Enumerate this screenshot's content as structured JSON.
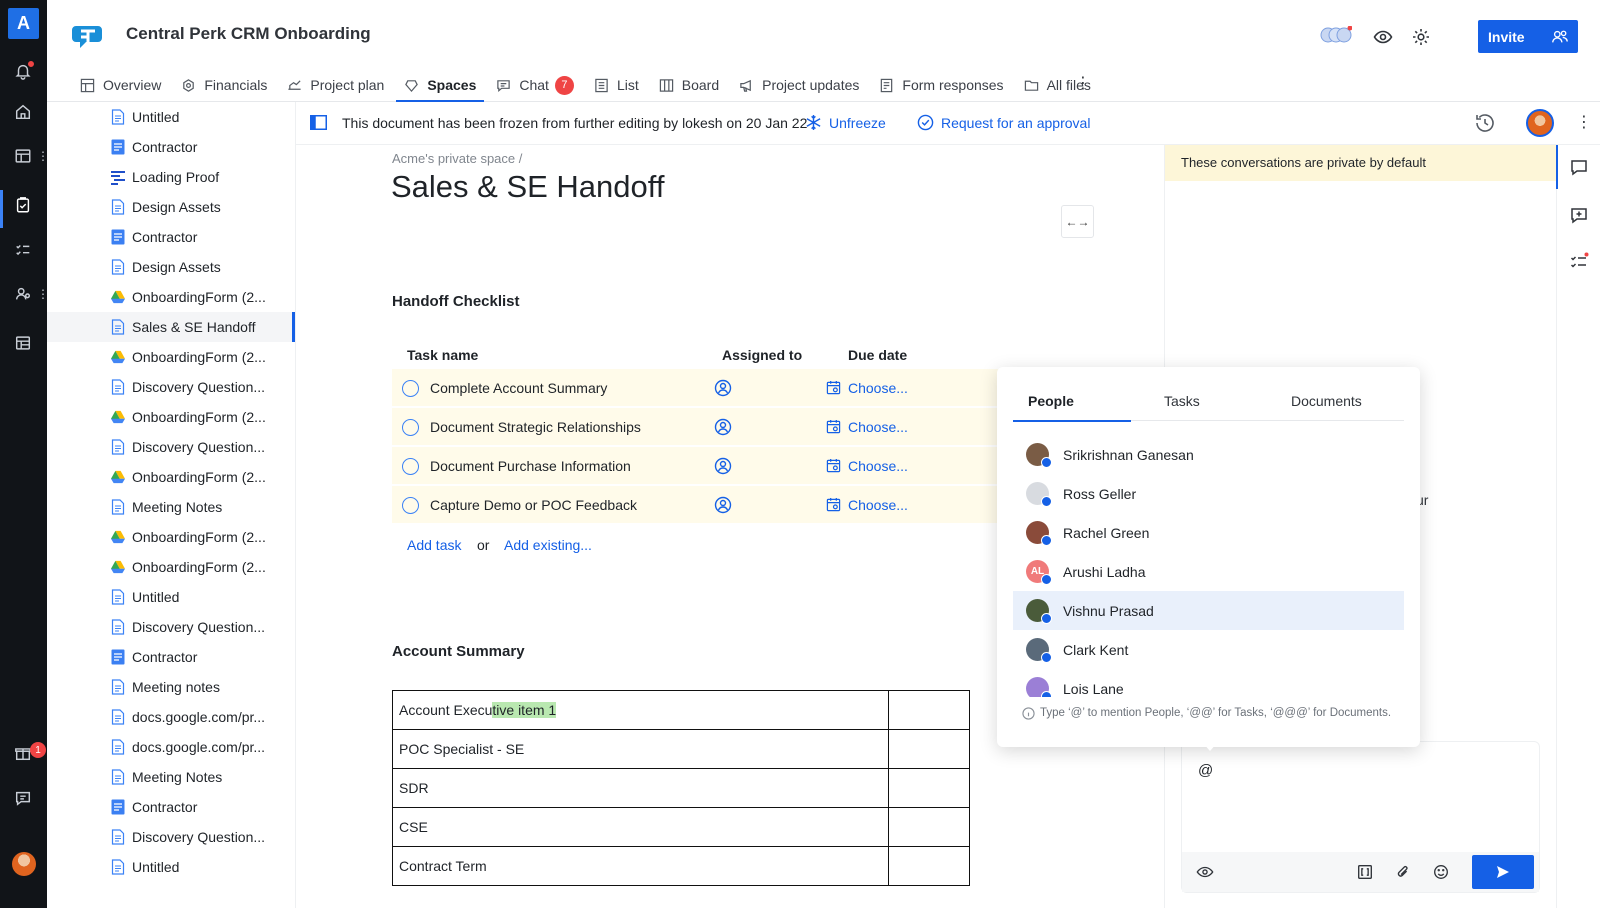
{
  "rail": {
    "logo": "A",
    "gift_badge": "1"
  },
  "header": {
    "project_title": "Central Perk CRM Onboarding",
    "invite_label": "Invite",
    "tabs": [
      {
        "label": "Overview",
        "icon": "overview-icon"
      },
      {
        "label": "Financials",
        "icon": "financials-icon"
      },
      {
        "label": "Project plan",
        "icon": "project-plan-icon"
      },
      {
        "label": "Spaces",
        "icon": "spaces-icon"
      },
      {
        "label": "Chat",
        "icon": "chat-icon",
        "count": "7"
      },
      {
        "label": "List",
        "icon": "list-icon"
      },
      {
        "label": "Board",
        "icon": "board-icon"
      },
      {
        "label": "Project updates",
        "icon": "megaphone-icon"
      },
      {
        "label": "Form responses",
        "icon": "form-icon"
      },
      {
        "label": "All files",
        "icon": "folder-icon"
      }
    ],
    "active_tab": "Spaces"
  },
  "tree": [
    {
      "label": "Untitled",
      "type": "doc"
    },
    {
      "label": "Contractor",
      "type": "gdoc"
    },
    {
      "label": "Loading Proof",
      "type": "lines"
    },
    {
      "label": "Design Assets",
      "type": "doc"
    },
    {
      "label": "Contractor",
      "type": "gdoc"
    },
    {
      "label": "Design Assets",
      "type": "doc"
    },
    {
      "label": "OnboardingForm (2...",
      "type": "drive"
    },
    {
      "label": "Sales & SE Handoff",
      "type": "doc",
      "active": true
    },
    {
      "label": "OnboardingForm (2...",
      "type": "drive"
    },
    {
      "label": "Discovery Question...",
      "type": "doc"
    },
    {
      "label": "OnboardingForm (2...",
      "type": "drive"
    },
    {
      "label": "Discovery Question...",
      "type": "doc"
    },
    {
      "label": "OnboardingForm (2...",
      "type": "drive"
    },
    {
      "label": "Meeting Notes",
      "type": "doc"
    },
    {
      "label": "OnboardingForm (2...",
      "type": "drive"
    },
    {
      "label": "OnboardingForm (2...",
      "type": "drive"
    },
    {
      "label": "Untitled",
      "type": "doc"
    },
    {
      "label": "Discovery Question...",
      "type": "doc"
    },
    {
      "label": "Contractor",
      "type": "gdoc"
    },
    {
      "label": "Meeting notes",
      "type": "doc"
    },
    {
      "label": "docs.google.com/pr...",
      "type": "doc"
    },
    {
      "label": "docs.google.com/pr...",
      "type": "doc"
    },
    {
      "label": "Meeting Notes",
      "type": "doc"
    },
    {
      "label": "Contractor",
      "type": "gdoc"
    },
    {
      "label": "Discovery Question...",
      "type": "doc"
    },
    {
      "label": "Untitled",
      "type": "doc"
    }
  ],
  "banner": {
    "text": "This document has been frozen from further editing by lokesh on 20 Jan 22",
    "unfreeze": "Unfreeze",
    "approval": "Request for an approval"
  },
  "doc": {
    "breadcrumb": "Acme's private space /",
    "title": "Sales & SE Handoff",
    "checklist_title": "Handoff Checklist",
    "columns": [
      "Task name",
      "Assigned to",
      "Due date"
    ],
    "tasks": [
      {
        "name": "Complete Account Summary",
        "due": "Choose..."
      },
      {
        "name": "Document Strategic Relationships",
        "due": "Choose..."
      },
      {
        "name": "Document Purchase Information",
        "due": "Choose..."
      },
      {
        "name": "Capture Demo or POC Feedback",
        "due": "Choose..."
      }
    ],
    "add_task": "Add task",
    "or": "or",
    "add_existing": "Add existing...",
    "summary_title": "Account Summary",
    "summary_rows": [
      {
        "pre": "Account Execu",
        "hl": "tive item 1"
      },
      {
        "pre": "POC Specialist - SE",
        "hl": ""
      },
      {
        "pre": "SDR",
        "hl": ""
      },
      {
        "pre": "CSE",
        "hl": ""
      },
      {
        "pre": "Contract Term",
        "hl": ""
      }
    ]
  },
  "chat": {
    "private_note": "These conversations are private by default",
    "partial_text": "ur",
    "composer_text": "@"
  },
  "mention": {
    "tabs": [
      "People",
      "Tasks",
      "Documents"
    ],
    "active_tab": "People",
    "people": [
      {
        "name": "Srikrishnan Ganesan",
        "color": "#7a5c45"
      },
      {
        "name": "Ross Geller",
        "color": "#d8dbe0"
      },
      {
        "name": "Rachel Green",
        "color": "#8a4b3a"
      },
      {
        "name": "Arushi Ladha",
        "color": "#f07a7a",
        "initials": "AL"
      },
      {
        "name": "Vishnu Prasad",
        "color": "#4a5b3a",
        "selected": true
      },
      {
        "name": "Clark Kent",
        "color": "#5a6a7a"
      },
      {
        "name": "Lois Lane",
        "color": "#9b7fd6"
      }
    ],
    "hint": "Type ‘@’ to mention People, ‘@@’ for Tasks, ‘@@@’ for Documents."
  }
}
